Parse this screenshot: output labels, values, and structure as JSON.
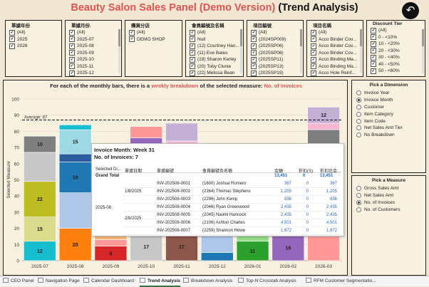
{
  "title": {
    "part1": "Beauty Salon Sales Panel (Demo Version)",
    "part2": "(Trend Analysis)"
  },
  "back_button": {
    "icon": "back-arrow-icon"
  },
  "filters": [
    {
      "header": "單據年份",
      "items": [
        {
          "label": "(All)",
          "checked": true
        },
        {
          "label": "2025",
          "checked": true
        },
        {
          "label": "2026",
          "checked": true
        }
      ]
    },
    {
      "header": "單據月份.",
      "items": [
        {
          "label": "(All)",
          "checked": true
        },
        {
          "label": "2025-07",
          "checked": true
        },
        {
          "label": "2025-08",
          "checked": true
        },
        {
          "label": "2025-09",
          "checked": true
        },
        {
          "label": "2025-10",
          "checked": true
        },
        {
          "label": "2025-11",
          "checked": true
        },
        {
          "label": "2025-12",
          "checked": true
        }
      ]
    },
    {
      "header": "購買分店",
      "items": [
        {
          "label": "(All)",
          "checked": true
        },
        {
          "label": "DEMO SHOP",
          "checked": true
        }
      ]
    },
    {
      "header": "會員編號及名稱",
      "items": [
        {
          "label": "(All)",
          "checked": true
        },
        {
          "label": "Null",
          "checked": true
        },
        {
          "label": "(12) Courtney Han...",
          "checked": true
        },
        {
          "label": "(11) Eve Bates",
          "checked": true
        },
        {
          "label": "(19) Sharon Kerley",
          "checked": true
        },
        {
          "label": "(20) Toby Clunie",
          "checked": true
        },
        {
          "label": "(22) Melissa Bean",
          "checked": true
        }
      ]
    },
    {
      "header": "項目編號",
      "items": [
        {
          "label": "(All)",
          "checked": true
        },
        {
          "label": "(2024SP009)",
          "checked": true
        },
        {
          "label": "(2025SP06)",
          "checked": true
        },
        {
          "label": "(2025SP08)",
          "checked": true
        },
        {
          "label": "(2025SP11)",
          "checked": true
        },
        {
          "label": "(2025SP13)",
          "checked": true
        },
        {
          "label": "(2025SP19)",
          "checked": true
        }
      ]
    },
    {
      "header": "項目名稱",
      "items": [
        {
          "label": "(All)",
          "checked": true
        },
        {
          "label": "Acco Binder Cov...",
          "checked": true
        },
        {
          "label": "Acco Binder Cov...",
          "checked": true
        },
        {
          "label": "Acco Binder Cov...",
          "checked": true
        },
        {
          "label": "Acco Binding Ma...",
          "checked": true
        },
        {
          "label": "Acco Binding Ma...",
          "checked": true
        },
        {
          "label": "Acco Hole Reinf...",
          "checked": true
        }
      ]
    },
    {
      "header": "Discount Tier",
      "items": [
        {
          "label": "(All)",
          "checked": true
        },
        {
          "label": "0 - <10%",
          "checked": true
        },
        {
          "label": "10 - <20%",
          "checked": true
        },
        {
          "label": "20 - <30%",
          "checked": true
        },
        {
          "label": "30 - <40%",
          "checked": true
        },
        {
          "label": "40 - <50%",
          "checked": true
        },
        {
          "label": "50 - <60%",
          "checked": true
        }
      ]
    }
  ],
  "chart_subtitle": {
    "part1": "For each of the monthly bars, there is a ",
    "part2": "weekly breakdown",
    "part3": " of the selected measure: ",
    "part4": "No. of Invoices"
  },
  "chart_data": {
    "type": "bar",
    "stacked": true,
    "ylabel": "Selected Measure",
    "ylim": [
      0,
      100
    ],
    "yticks": [
      0,
      10,
      20,
      30,
      40,
      50,
      60,
      70,
      80,
      90,
      100
    ],
    "average": 87,
    "average_label": "Average: 87",
    "categories": [
      "2025-07",
      "2025-08",
      "2025-09",
      "2025-10",
      "2025-11",
      "2025-12",
      "2026-01",
      "2026-02",
      "2026-03"
    ],
    "segments": [
      [
        {
          "v": 12,
          "c": "#17becf",
          "l": "12"
        },
        {
          "v": 15,
          "c": "#dbdb8d",
          "l": "15"
        },
        {
          "v": 22,
          "c": "#bcbd22",
          "l": "22"
        },
        {
          "v": 18,
          "c": "#c7c7c7",
          "l": ""
        },
        {
          "v": 10,
          "c": "#7f7f7f",
          "l": "10"
        }
      ],
      [
        {
          "v": 20,
          "c": "#ff7f0e",
          "l": "20"
        },
        {
          "v": 22,
          "c": "#aec7e8",
          "l": ""
        },
        {
          "v": 19,
          "c": "#1f77b4",
          "l": "19"
        },
        {
          "v": 5,
          "c": "#2b5c9e",
          "l": ""
        },
        {
          "v": 15,
          "c": "#9edae5",
          "l": "15"
        },
        {
          "v": 3,
          "c": "#17becf",
          "l": ""
        }
      ],
      [
        {
          "v": 9,
          "c": "#d62728",
          "l": "9"
        },
        {
          "v": 4,
          "c": "#ff9896",
          "l": ""
        },
        {
          "v": 6,
          "c": "#ffbb78",
          "l": ""
        },
        {
          "v": 19,
          "c": "#ffbb78",
          "l": "19"
        }
      ],
      [
        {
          "v": 17,
          "c": "#c7c7c7",
          "l": "17"
        },
        {
          "v": 17,
          "c": "#c5b0d5",
          "l": ""
        },
        {
          "v": 25,
          "c": "#7a5ec5",
          "l": ""
        },
        {
          "v": 17,
          "c": "#9467bd",
          "l": "17"
        },
        {
          "v": 7,
          "c": "#ff9896",
          "l": ""
        }
      ],
      [
        {
          "v": 17,
          "c": "#8c564b",
          "l": "17"
        },
        {
          "v": 21,
          "c": "#c49c94",
          "l": ""
        },
        {
          "v": 22,
          "c": "#e377c2",
          "l": "22"
        },
        {
          "v": 14,
          "c": "#f7b6d2",
          "l": ""
        },
        {
          "v": 11,
          "c": "#c5b0d5",
          "l": ""
        }
      ],
      [
        {
          "v": 5,
          "c": "#1f77b4",
          "l": ""
        },
        {
          "v": 13,
          "c": "#aec7e8",
          "l": ""
        },
        {
          "v": 18,
          "c": "#d4e27a",
          "l": ""
        },
        {
          "v": 25,
          "c": "#bcbd22",
          "l": "25"
        }
      ],
      [
        {
          "v": 12,
          "c": "#2ca02c",
          "l": "11"
        },
        {
          "v": 18,
          "c": "#98df8a",
          "l": ""
        },
        {
          "v": 30,
          "c": "#d62728",
          "l": ""
        }
      ],
      [
        {
          "v": 16,
          "c": "#9467bd",
          "l": "16"
        },
        {
          "v": 26,
          "c": "#c5b0d5",
          "l": ""
        },
        {
          "v": 24,
          "c": "#8c564b",
          "l": ""
        }
      ],
      [
        {
          "v": 15,
          "c": "#ff9896",
          "l": ""
        },
        {
          "v": 15,
          "c": "#e377c2",
          "l": ""
        },
        {
          "v": 18,
          "c": "#f7b6d2",
          "l": ""
        },
        {
          "v": 33,
          "c": "#7f7f7f",
          "l": ""
        },
        {
          "v": 4,
          "c": "#f7b6d2",
          "l": ""
        },
        {
          "v": 10,
          "c": "#c5b0d5",
          "l": "12"
        }
      ]
    ]
  },
  "tooltip": {
    "line1": "Invoice Month: Week 31",
    "line2": "No. of Invoices: 7",
    "columns": [
      "Selected Di...",
      "單據日期",
      "單據編號",
      "會員編號及名稱",
      "金額",
      "折扣(S)",
      "折扣比金..."
    ],
    "grand_total": {
      "label": "Grand Total",
      "amount": "13,451",
      "disc": "0",
      "ratio": "13,451"
    },
    "month": "2025-08",
    "rows": [
      {
        "date": "1/8/2025",
        "inv": "INV-202508-0001",
        "member": "(1600) Joshua Romero",
        "amt": "367",
        "disc": "0",
        "ratio": "367"
      },
      {
        "date": "",
        "inv": "INV-202508-0002",
        "member": "(2364) Thomas Stephens",
        "amt": "1,205",
        "disc": "0",
        "ratio": "1,205"
      },
      {
        "date": "",
        "inv": "INV-202508-0003",
        "member": "(2296) John Kemp",
        "amt": "836",
        "disc": "0",
        "ratio": "836"
      },
      {
        "date": "",
        "inv": "INV-202508-0004",
        "member": "(2046) Ryan Greenwood",
        "amt": "2,435",
        "disc": "0",
        "ratio": "2,435"
      },
      {
        "date": "2/8/2025",
        "inv": "INV-202508-0005",
        "member": "(2045) Naomi Hancock",
        "amt": "2,435",
        "disc": "0",
        "ratio": "2,435"
      },
      {
        "date": "",
        "inv": "INV-202508-0006",
        "member": "(2106) Ashton Charles",
        "amt": "4,501",
        "disc": "0",
        "ratio": "4,501"
      },
      {
        "date": "",
        "inv": "INV-202508-0007",
        "member": "(2259) Shannon Howe",
        "amt": "1,672",
        "disc": "0",
        "ratio": "1,672"
      }
    ]
  },
  "dimension_panel": {
    "header": "Pick a Dimension",
    "options": [
      {
        "label": "Invoice Year",
        "selected": false
      },
      {
        "label": "Invoice Month",
        "selected": true
      },
      {
        "label": "Customer",
        "selected": false
      },
      {
        "label": "Item Category",
        "selected": false
      },
      {
        "label": "Item Code",
        "selected": false
      },
      {
        "label": "Net Sales Amt Tier",
        "selected": false
      },
      {
        "label": "No Breakdown",
        "selected": false
      }
    ]
  },
  "measure_panel": {
    "header": "Pick a Measure",
    "options": [
      {
        "label": "Gross Sales Amt",
        "selected": false
      },
      {
        "label": "Net Sales Amt",
        "selected": false
      },
      {
        "label": "No. of Invoices",
        "selected": true
      },
      {
        "label": "No. of Customers",
        "selected": false
      }
    ]
  },
  "tabs": [
    {
      "label": "CEO Panel",
      "active": false
    },
    {
      "label": "Navigation Page",
      "active": false
    },
    {
      "label": "Calendar Dashboard",
      "active": false
    },
    {
      "label": "Trend Analysis",
      "active": true
    },
    {
      "label": "Breakdown Analysis",
      "active": false
    },
    {
      "label": "Top-N Crosstab Analysis",
      "active": false
    },
    {
      "label": "RFM Customer Segmentatio...",
      "active": false
    }
  ]
}
